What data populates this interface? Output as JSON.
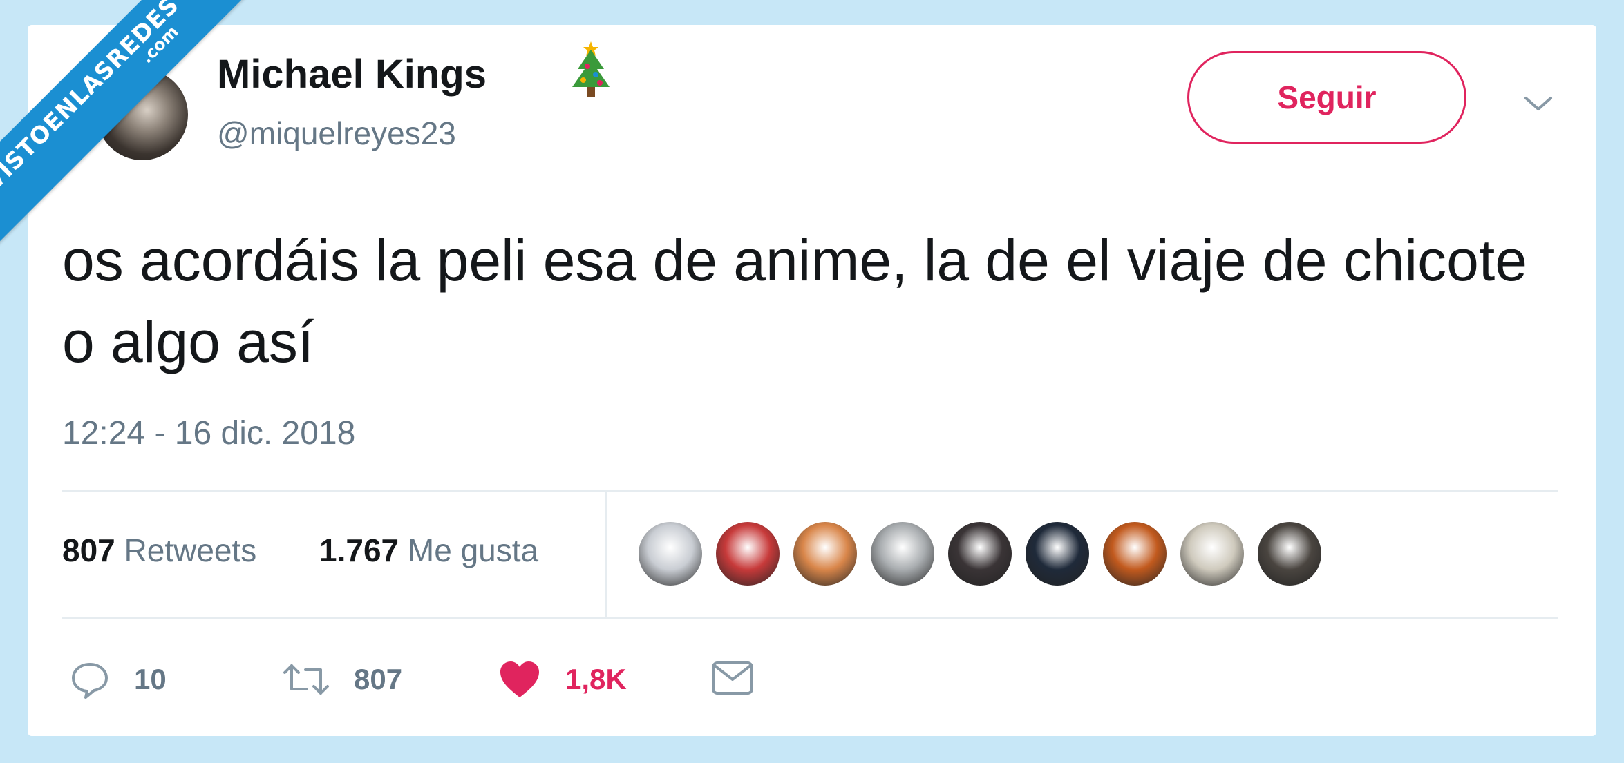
{
  "watermark": {
    "line1": "VISTOENLASREDES",
    "line2": ".com"
  },
  "tweet": {
    "author_name": "Michael Kings",
    "author_emoji_icon": "christmas-tree-icon",
    "handle": "@miquelreyes23",
    "follow_label": "Seguir",
    "text": "os acordáis la peli esa de anime, la de el viaje de chicote o algo así",
    "timestamp": "12:24 - 16 dic. 2018",
    "stats": {
      "retweets_count": "807",
      "retweets_label": "Retweets",
      "likes_count": "1.767",
      "likes_label": "Me gusta"
    },
    "likers": [
      {
        "color": "#c9cdd3"
      },
      {
        "color": "#c73a3a"
      },
      {
        "color": "#d9864a"
      },
      {
        "color": "#a9adb0"
      },
      {
        "color": "#3a3436"
      },
      {
        "color": "#1f2a3a"
      },
      {
        "color": "#c25a1e"
      },
      {
        "color": "#cfcabd"
      },
      {
        "color": "#4a4540"
      }
    ],
    "actions": {
      "replies": "10",
      "retweets": "807",
      "likes": "1,8K"
    }
  },
  "colors": {
    "background": "#c7e7f7",
    "accent": "#e0245e",
    "secondary_text": "#657786",
    "primary_text": "#14171a",
    "watermark_blue": "#1b8fd2"
  }
}
